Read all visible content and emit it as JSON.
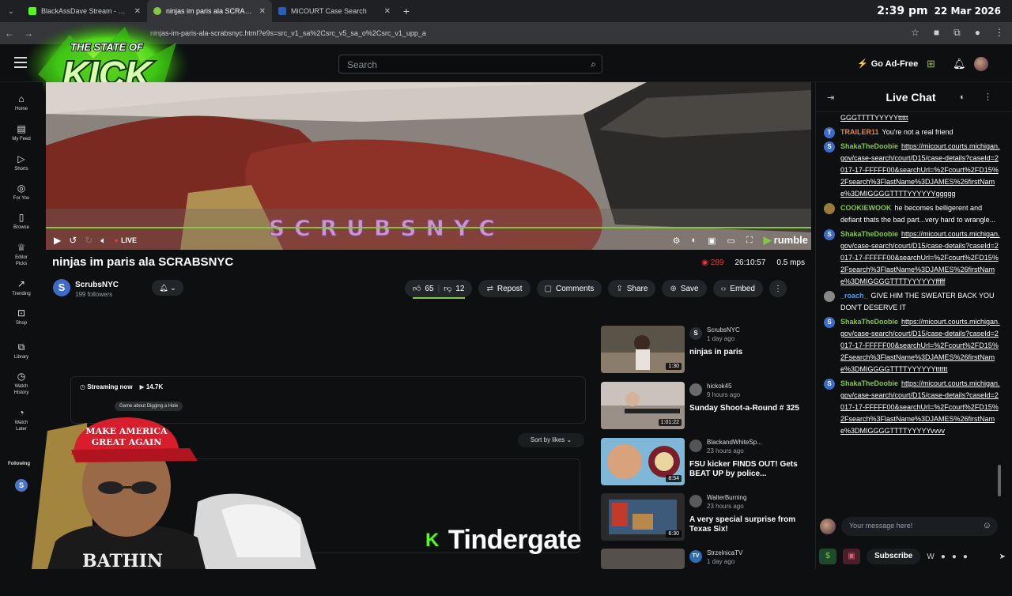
{
  "browser": {
    "tabs": [
      {
        "title": "BlackAssDave Stream - Watch L",
        "color": "#53fc18",
        "active": false
      },
      {
        "title": "ninjas im paris ala SCRABSNYC",
        "color": "#85c742",
        "active": true
      },
      {
        "title": "MiCOURT Case Search",
        "color": "#2b5fb5",
        "active": false
      }
    ],
    "url": "ninjas-im-paris-ala-scrabsnyc.html?e9s=src_v1_sa%2Csrc_v5_sa_o%2Csrc_v1_upp_a",
    "clock_time": "2:39 pm",
    "clock_date": "22 Mar 2026"
  },
  "header": {
    "search_placeholder": "Search",
    "go_ad_free": "Go Ad-Free"
  },
  "logo": {
    "line1": "THE STATE OF",
    "line2": "KICK"
  },
  "leftnav": {
    "items": [
      {
        "label": "Home",
        "icon": "home-icon"
      },
      {
        "label": "My Feed",
        "icon": "feed-icon"
      },
      {
        "label": "Shorts",
        "icon": "shorts-icon"
      },
      {
        "label": "For You",
        "icon": "for-you-icon"
      },
      {
        "label": "Browse",
        "icon": "browse-icon"
      },
      {
        "label": "Editor Picks",
        "icon": "editor-picks-icon"
      },
      {
        "label": "Trending",
        "icon": "trending-icon"
      },
      {
        "label": "Shop",
        "icon": "shop-icon"
      },
      {
        "label": "Library",
        "icon": "library-icon"
      },
      {
        "label": "Watch History",
        "icon": "history-icon"
      },
      {
        "label": "Watch Later",
        "icon": "watch-later-icon"
      }
    ],
    "following": "Following",
    "following_avatar": "S"
  },
  "video": {
    "overlay_text": "SCRUBSNYC",
    "live_label": "LIVE",
    "brand": "rumble",
    "title": "ninjas im paris ala SCRABSNYC",
    "viewers": "289",
    "duration": "26:10:57",
    "bitrate": "0.5 mps"
  },
  "channel": {
    "avatar": "S",
    "name": "ScrubsNYC",
    "followers": "199 followers"
  },
  "actions": {
    "likes": "65",
    "dislikes": "12",
    "like_ratio": 0.84,
    "repost": "Repost",
    "comments": "Comments",
    "share": "Share",
    "save": "Save",
    "embed": "Embed"
  },
  "description": {
    "streaming_now": "Streaming now",
    "views": "14.7K",
    "game_chip": "Game about Digging a Hole",
    "sort": "Sort by likes"
  },
  "related": [
    {
      "channel": "ScrubsNYC",
      "avatar": "S",
      "age": "1 day ago",
      "title": "ninjas in paris",
      "duration": "1:30"
    },
    {
      "channel": "hickok45",
      "avatar": "",
      "age": "9 hours ago",
      "title": "Sunday Shoot-a-Round # 325",
      "duration": "1:01:22"
    },
    {
      "channel": "BlackandWhiteSp...",
      "avatar": "",
      "age": "23 hours ago",
      "title": "FSU kicker FINDS OUT! Gets BEAT UP by police...",
      "duration": "8:54"
    },
    {
      "channel": "WalterBurning",
      "avatar": "",
      "age": "23 hours ago",
      "title": "A very special surprise from Texas Six!",
      "duration": "6:30"
    },
    {
      "channel": "StrzelnicaTV",
      "avatar": "TV",
      "age": "1 day ago",
      "title": "",
      "duration": ""
    }
  ],
  "overlay": {
    "tindergate": "Tindergate"
  },
  "chat": {
    "title": "Live Chat",
    "input_placeholder": "Your message here!",
    "subscribe": "Subscribe",
    "messages": [
      {
        "user": "",
        "color": "#fff",
        "avatar": "",
        "avatar_color": "#0d0f11",
        "text": "GGGTTTTYYYYYttttt",
        "link": true
      },
      {
        "user": "TRAILER11",
        "color": "#e0884a",
        "avatar": "T",
        "avatar_color": "#3d6cc7",
        "text": "You're not a real friend",
        "link": false
      },
      {
        "user": "ShakaTheDoobie",
        "color": "#85c742",
        "avatar": "S",
        "avatar_color": "#3d6cc7",
        "text": "https://micourt.courts.michigan.gov/case-search/court/D15/case-details?caseId=2017-17-FFFFF00&searchUrl=%2Fcourt%2FD15%2Fsearch%3FlastName%3DJAMES%26firstName%3DMIGGGGTTTTYYYYYYggggg",
        "link": true
      },
      {
        "user": "COOKIEWOOK",
        "color": "#85c742",
        "avatar": "",
        "avatar_color": "#9a7a3a",
        "text": "he becomes belligerent and defiant thats the bad part...very hard to wrangle...",
        "link": false
      },
      {
        "user": "ShakaTheDoobie",
        "color": "#85c742",
        "avatar": "S",
        "avatar_color": "#3d6cc7",
        "text": "https://micourt.courts.michigan.gov/case-search/court/D15/case-details?caseId=2017-17-FFFFF00&searchUrl=%2Fcourt%2FD15%2Fsearch%3FlastName%3DJAMES%26firstName%3DMIGGGGTTTTYYYYYYfffff",
        "link": true
      },
      {
        "user": "_roach_",
        "color": "#4c9be8",
        "avatar": "",
        "avatar_color": "#888",
        "text": "GIVE HIM THE SWEATER BACK YOU DON'T DESERVE IT",
        "link": false
      },
      {
        "user": "ShakaTheDoobie",
        "color": "#85c742",
        "avatar": "S",
        "avatar_color": "#3d6cc7",
        "text": "https://micourt.courts.michigan.gov/case-search/court/D15/case-details?caseId=2017-17-FFFFF00&searchUrl=%2Fcourt%2FD15%2Fsearch%3FlastName%3DJAMES%26firstName%3DMIGGGGTTTTYYYYYYtttttt",
        "link": true
      },
      {
        "user": "ShakaTheDoobie",
        "color": "#85c742",
        "avatar": "S",
        "avatar_color": "#3d6cc7",
        "text": "https://micourt.courts.michigan.gov/case-search/court/D15/case-details?caseId=2017-17-FFFFF00&searchUrl=%2Fcourt%2FD15%2Fsearch%3FlastName%3DJAMES%26firstName%3DMIGGGGTTTTYYYYYvvvv",
        "link": true
      }
    ]
  }
}
